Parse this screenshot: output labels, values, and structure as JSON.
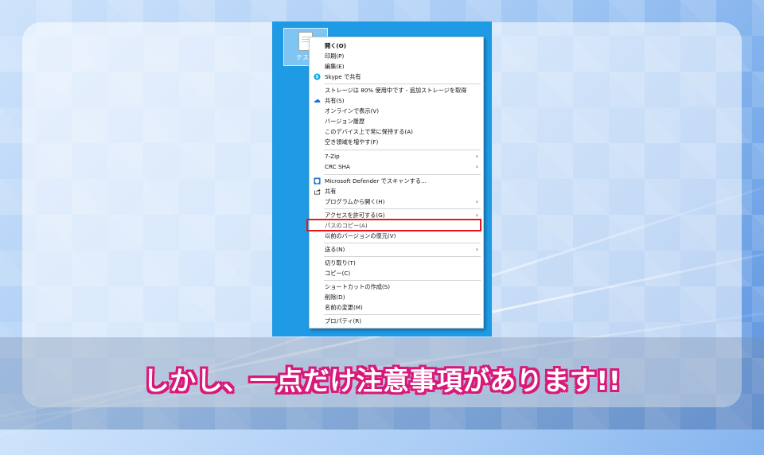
{
  "desktop": {
    "file_label": "テスト"
  },
  "menu": {
    "items": [
      {
        "label": "開く(O)",
        "bold": true
      },
      {
        "label": "印刷(P)"
      },
      {
        "label": "編集(E)"
      },
      {
        "label": "Skype で共有",
        "icon": "skype-icon"
      },
      {
        "label": "ストレージは 80% 使用中です - 追加ストレージを取得"
      },
      {
        "label": "共有(S)",
        "icon": "onedrive-cloud-icon"
      },
      {
        "label": "オンラインで表示(V)"
      },
      {
        "label": "バージョン履歴"
      },
      {
        "label": "このデバイス上で常に保持する(A)"
      },
      {
        "label": "空き領域を増やす(F)"
      },
      {
        "label": "7-Zip",
        "submenu": true
      },
      {
        "label": "CRC SHA",
        "submenu": true
      },
      {
        "label": "Microsoft Defender でスキャンする...",
        "icon": "defender-shield-icon"
      },
      {
        "label": "共有",
        "icon": "share-icon"
      },
      {
        "label": "プログラムから開く(H)",
        "submenu": true
      },
      {
        "label": "アクセスを許可する(G)",
        "submenu": true
      },
      {
        "label": "パスのコピー(A)",
        "highlighted": true
      },
      {
        "label": "以前のバージョンの復元(V)"
      },
      {
        "label": "送る(N)",
        "submenu": true
      },
      {
        "label": "切り取り(T)"
      },
      {
        "label": "コピー(C)"
      },
      {
        "label": "ショートカットの作成(S)"
      },
      {
        "label": "削除(D)"
      },
      {
        "label": "名前の変更(M)"
      },
      {
        "label": "プロパティ(R)"
      }
    ],
    "highlight_color": "#e8141e",
    "submenu_glyph": "›"
  },
  "caption": {
    "text": "しかし、一点だけ注意事項があります!!"
  }
}
